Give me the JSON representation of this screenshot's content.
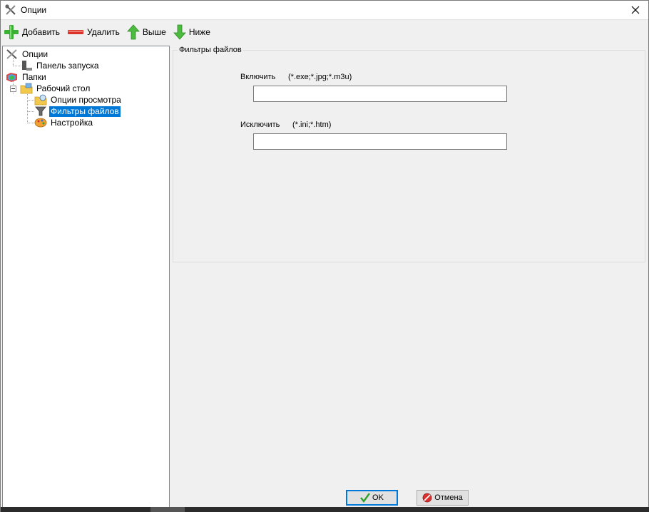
{
  "window": {
    "title": "Опции",
    "icon": "tools-icon",
    "close_icon": "close-icon"
  },
  "toolbar": {
    "add_label": "Добавить",
    "delete_label": "Удалить",
    "up_label": "Выше",
    "down_label": "Ниже"
  },
  "tree": {
    "items": [
      {
        "label": "Опции",
        "icon": "tools-icon"
      },
      {
        "label": "Панель запуска",
        "icon": "launch-panel-icon"
      },
      {
        "label": "Папки",
        "icon": "folders-icon"
      },
      {
        "label": "Рабочий стол",
        "icon": "desktop-folder-icon"
      },
      {
        "label": "Опции просмотра",
        "icon": "view-options-icon"
      },
      {
        "label": "Фильтры файлов",
        "icon": "filter-icon",
        "selected": true
      },
      {
        "label": "Настройка",
        "icon": "settings-palette-icon"
      }
    ]
  },
  "filters": {
    "group_title": "Фильтры файлов",
    "include_label": "Включить",
    "include_hint": "(*.exe;*.jpg;*.m3u)",
    "include_value": "",
    "exclude_label": "Исключить",
    "exclude_hint": "(*.ini;*.htm)",
    "exclude_value": ""
  },
  "buttons": {
    "ok_label": "OK",
    "cancel_label": "Отмена"
  },
  "colors": {
    "selection": "#0078d7",
    "window_bg": "#f0f0f0"
  }
}
